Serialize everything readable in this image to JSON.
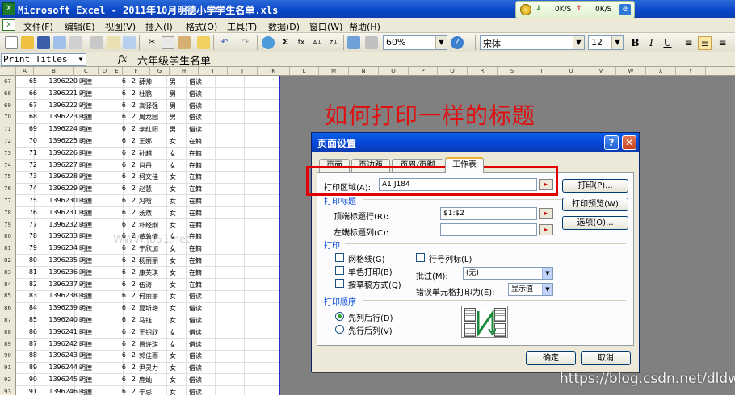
{
  "window": {
    "title": "Microsoft Excel - 2011年10月明德小学学生名单.xls"
  },
  "net_widget": {
    "down_label": "0K/S",
    "up_label": "0K/S"
  },
  "menu": {
    "items": [
      "文件(F)",
      "编辑(E)",
      "视图(V)",
      "插入(I)",
      "格式(O)",
      "工具(T)",
      "数据(D)",
      "窗口(W)",
      "帮助(H)"
    ]
  },
  "toolbar": {
    "zoom": "60%",
    "font": "宋体",
    "font_size": "12"
  },
  "formula_bar": {
    "name_box": "Print_Titles",
    "fx": "fx",
    "value": "六年级学生名单"
  },
  "sheet": {
    "columns": [
      "A",
      "B",
      "C",
      "D",
      "E",
      "F",
      "G",
      "H",
      "I",
      "J",
      "K",
      "L",
      "M",
      "N",
      "O",
      "P",
      "Q",
      "R",
      "S",
      "T",
      "U",
      "V",
      "W",
      "X",
      "Y"
    ],
    "rows": [
      {
        "n": "67",
        "a": "65",
        "b": "1396220",
        "c": "明德",
        "d": "6",
        "e": "2",
        "f": "薛帅",
        "g": "男",
        "h": "借读"
      },
      {
        "n": "68",
        "a": "66",
        "b": "1396221",
        "c": "明德",
        "d": "6",
        "e": "2",
        "f": "杜鹏",
        "g": "男",
        "h": "借读"
      },
      {
        "n": "69",
        "a": "67",
        "b": "1396222",
        "c": "明德",
        "d": "6",
        "e": "2",
        "f": "高驿强",
        "g": "男",
        "h": "借读"
      },
      {
        "n": "70",
        "a": "68",
        "b": "1396223",
        "c": "明德",
        "d": "6",
        "e": "2",
        "f": "周龙园",
        "g": "男",
        "h": "借读"
      },
      {
        "n": "71",
        "a": "69",
        "b": "1396224",
        "c": "明德",
        "d": "6",
        "e": "2",
        "f": "李红阳",
        "g": "男",
        "h": "借读"
      },
      {
        "n": "72",
        "a": "70",
        "b": "1396225",
        "c": "明德",
        "d": "6",
        "e": "2",
        "f": "王娜",
        "g": "女",
        "h": "在籍"
      },
      {
        "n": "73",
        "a": "71",
        "b": "1396226",
        "c": "明德",
        "d": "6",
        "e": "2",
        "f": "孙越",
        "g": "女",
        "h": "在籍"
      },
      {
        "n": "74",
        "a": "72",
        "b": "1396227",
        "c": "明德",
        "d": "6",
        "e": "2",
        "f": "肖丹",
        "g": "女",
        "h": "在籍"
      },
      {
        "n": "75",
        "a": "73",
        "b": "1396228",
        "c": "明德",
        "d": "6",
        "e": "2",
        "f": "柯文佳",
        "g": "女",
        "h": "在籍"
      },
      {
        "n": "76",
        "a": "74",
        "b": "1396229",
        "c": "明德",
        "d": "6",
        "e": "2",
        "f": "赵慧",
        "g": "女",
        "h": "在籍"
      },
      {
        "n": "77",
        "a": "75",
        "b": "1396230",
        "c": "明德",
        "d": "6",
        "e": "2",
        "f": "冯晗",
        "g": "女",
        "h": "在籍"
      },
      {
        "n": "78",
        "a": "76",
        "b": "1396231",
        "c": "明德",
        "d": "6",
        "e": "2",
        "f": "汤然",
        "g": "女",
        "h": "在籍"
      },
      {
        "n": "79",
        "a": "77",
        "b": "1396232",
        "c": "明德",
        "d": "6",
        "e": "2",
        "f": "朴经纲",
        "g": "女",
        "h": "在籍"
      },
      {
        "n": "80",
        "a": "78",
        "b": "1396233",
        "c": "明德",
        "d": "6",
        "e": "2",
        "f": "黄敦倩",
        "g": "女",
        "h": "在籍"
      },
      {
        "n": "81",
        "a": "79",
        "b": "1396234",
        "c": "明德",
        "d": "6",
        "e": "2",
        "f": "于欣加",
        "g": "女",
        "h": "在籍"
      },
      {
        "n": "82",
        "a": "80",
        "b": "1396235",
        "c": "明德",
        "d": "6",
        "e": "2",
        "f": "杨丽丽",
        "g": "女",
        "h": "在籍"
      },
      {
        "n": "83",
        "a": "81",
        "b": "1396236",
        "c": "明德",
        "d": "6",
        "e": "2",
        "f": "康芙琪",
        "g": "女",
        "h": "在籍"
      },
      {
        "n": "84",
        "a": "82",
        "b": "1396237",
        "c": "明德",
        "d": "6",
        "e": "2",
        "f": "伍涛",
        "g": "女",
        "h": "在籍"
      },
      {
        "n": "85",
        "a": "83",
        "b": "1396238",
        "c": "明德",
        "d": "6",
        "e": "2",
        "f": "何丽丽",
        "g": "女",
        "h": "借读"
      },
      {
        "n": "86",
        "a": "84",
        "b": "1396239",
        "c": "明德",
        "d": "6",
        "e": "2",
        "f": "夏圻艳",
        "g": "女",
        "h": "借读"
      },
      {
        "n": "87",
        "a": "85",
        "b": "1396240",
        "c": "明德",
        "d": "6",
        "e": "2",
        "f": "马钰",
        "g": "女",
        "h": "借读"
      },
      {
        "n": "88",
        "a": "86",
        "b": "1396241",
        "c": "明德",
        "d": "6",
        "e": "2",
        "f": "王钥欣",
        "g": "女",
        "h": "借读"
      },
      {
        "n": "89",
        "a": "87",
        "b": "1396242",
        "c": "明德",
        "d": "6",
        "e": "2",
        "f": "愚许琪",
        "g": "女",
        "h": "借读"
      },
      {
        "n": "90",
        "a": "88",
        "b": "1396243",
        "c": "明德",
        "d": "6",
        "e": "2",
        "f": "郭佳雨",
        "g": "女",
        "h": "借读"
      },
      {
        "n": "91",
        "a": "89",
        "b": "1396244",
        "c": "明德",
        "d": "6",
        "e": "2",
        "f": "尹灵力",
        "g": "女",
        "h": "借读"
      },
      {
        "n": "92",
        "a": "90",
        "b": "1396245",
        "c": "明德",
        "d": "6",
        "e": "2",
        "f": "鹿灿",
        "g": "女",
        "h": "借读"
      },
      {
        "n": "93",
        "a": "91",
        "b": "1396246",
        "c": "明德",
        "d": "6",
        "e": "2",
        "f": "于忌",
        "g": "女",
        "h": "借读"
      }
    ]
  },
  "overlay_heading": "如何打印一样的标题",
  "watermark": "https://blog.csdn.net/dldw777",
  "faint_watermark": "WWW.jb51.net",
  "dialog": {
    "title": "页面设置",
    "tabs": [
      "页面",
      "页边距",
      "页眉/页脚",
      "工作表"
    ],
    "print_area_label": "打印区域(A):",
    "print_area_value": "A1:J184",
    "print_titles_group": "打印标题",
    "top_rows_label": "顶端标题行(R):",
    "top_rows_value": "$1:$2",
    "left_cols_label": "左端标题列(C):",
    "left_cols_value": "",
    "print_group": "打印",
    "gridlines_label": "网格线(G)",
    "mono_label": "单色打印(B)",
    "draft_label": "按草稿方式(Q)",
    "rowcol_label": "行号列标(L)",
    "comments_label": "批注(M):",
    "comments_value": "(无)",
    "errors_label": "错误单元格打印为(E):",
    "errors_value": "显示值",
    "order_group": "打印顺序",
    "down_then_over": "先列后行(D)",
    "over_then_down": "先行后列(V)",
    "print_button": "打印(P)...",
    "preview_button": "打印预览(W)",
    "options_button": "选项(O)...",
    "ok_button": "确定",
    "cancel_button": "取消"
  }
}
